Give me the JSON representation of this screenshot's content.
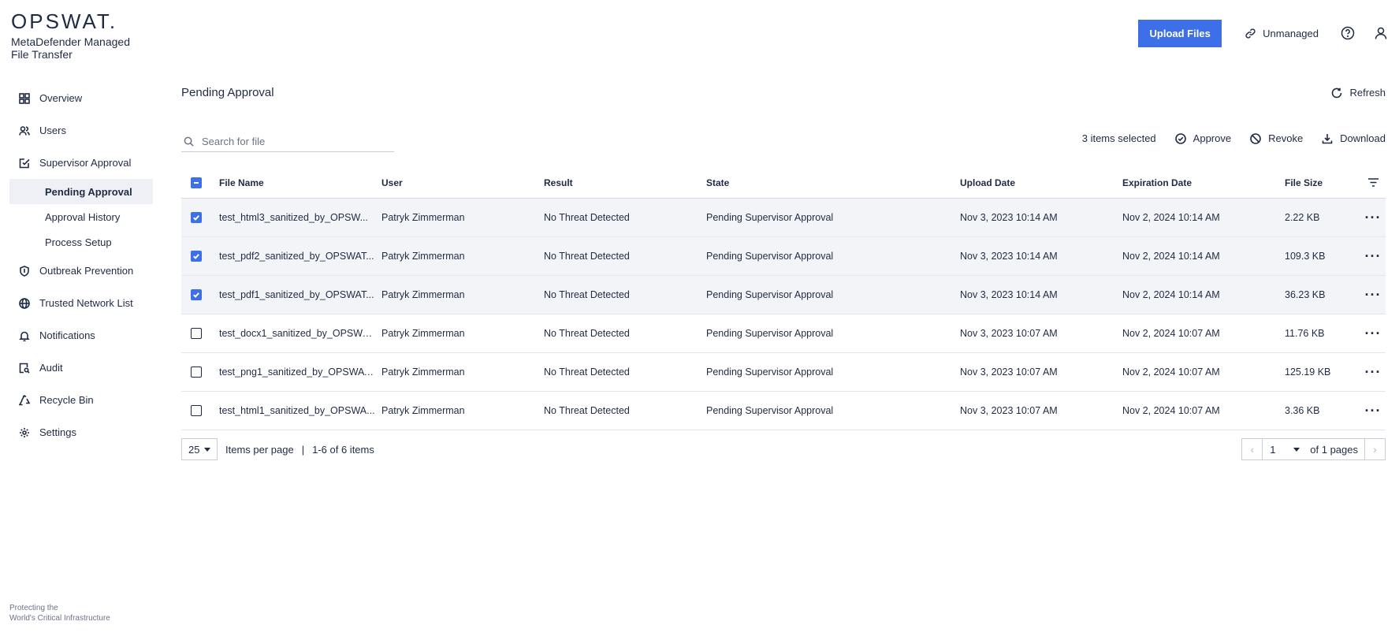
{
  "brand": {
    "logo": "OPSWAT.",
    "product": "MetaDefender Managed File Transfer",
    "tagline_line1": "Protecting the",
    "tagline_line2": "World's Critical Infrastructure"
  },
  "header": {
    "upload_label": "Upload Files",
    "unmanaged_label": "Unmanaged"
  },
  "sidebar": {
    "overview": "Overview",
    "users": "Users",
    "supervisor_approval": "Supervisor Approval",
    "pending_approval": "Pending Approval",
    "approval_history": "Approval History",
    "process_setup": "Process Setup",
    "outbreak_prevention": "Outbreak Prevention",
    "trusted_network_list": "Trusted Network List",
    "notifications": "Notifications",
    "audit": "Audit",
    "recycle_bin": "Recycle Bin",
    "settings": "Settings"
  },
  "main": {
    "title": "Pending Approval",
    "refresh_label": "Refresh",
    "search_placeholder": "Search for file",
    "selected_count": "3 items selected",
    "approve_label": "Approve",
    "revoke_label": "Revoke",
    "download_label": "Download"
  },
  "table": {
    "columns": {
      "file_name": "File Name",
      "user": "User",
      "result": "Result",
      "state": "State",
      "upload_date": "Upload Date",
      "expiration_date": "Expiration Date",
      "file_size": "File Size"
    },
    "rows": [
      {
        "name": "test_html3_sanitized_by_OPSW...",
        "user": "Patryk Zimmerman",
        "result": "No Threat Detected",
        "state": "Pending Supervisor Approval",
        "upload": "Nov 3, 2023 10:14 AM",
        "expire": "Nov 2, 2024 10:14 AM",
        "size": "2.22 KB"
      },
      {
        "name": "test_pdf2_sanitized_by_OPSWAT...",
        "user": "Patryk Zimmerman",
        "result": "No Threat Detected",
        "state": "Pending Supervisor Approval",
        "upload": "Nov 3, 2023 10:14 AM",
        "expire": "Nov 2, 2024 10:14 AM",
        "size": "109.3 KB"
      },
      {
        "name": "test_pdf1_sanitized_by_OPSWAT...",
        "user": "Patryk Zimmerman",
        "result": "No Threat Detected",
        "state": "Pending Supervisor Approval",
        "upload": "Nov 3, 2023 10:14 AM",
        "expire": "Nov 2, 2024 10:14 AM",
        "size": "36.23 KB"
      },
      {
        "name": "test_docx1_sanitized_by_OPSWA...",
        "user": "Patryk Zimmerman",
        "result": "No Threat Detected",
        "state": "Pending Supervisor Approval",
        "upload": "Nov 3, 2023 10:07 AM",
        "expire": "Nov 2, 2024 10:07 AM",
        "size": "11.76 KB"
      },
      {
        "name": "test_png1_sanitized_by_OPSWAT...",
        "user": "Patryk Zimmerman",
        "result": "No Threat Detected",
        "state": "Pending Supervisor Approval",
        "upload": "Nov 3, 2023 10:07 AM",
        "expire": "Nov 2, 2024 10:07 AM",
        "size": "125.19 KB"
      },
      {
        "name": "test_html1_sanitized_by_OPSWA...",
        "user": "Patryk Zimmerman",
        "result": "No Threat Detected",
        "state": "Pending Supervisor Approval",
        "upload": "Nov 3, 2023 10:07 AM",
        "expire": "Nov 2, 2024 10:07 AM",
        "size": "3.36 KB"
      }
    ]
  },
  "pagination": {
    "per_page": "25",
    "per_page_label": "Items per page",
    "separator": "|",
    "range": "1-6 of 6 items",
    "current_page": "1",
    "total_pages": "of 1 pages"
  }
}
